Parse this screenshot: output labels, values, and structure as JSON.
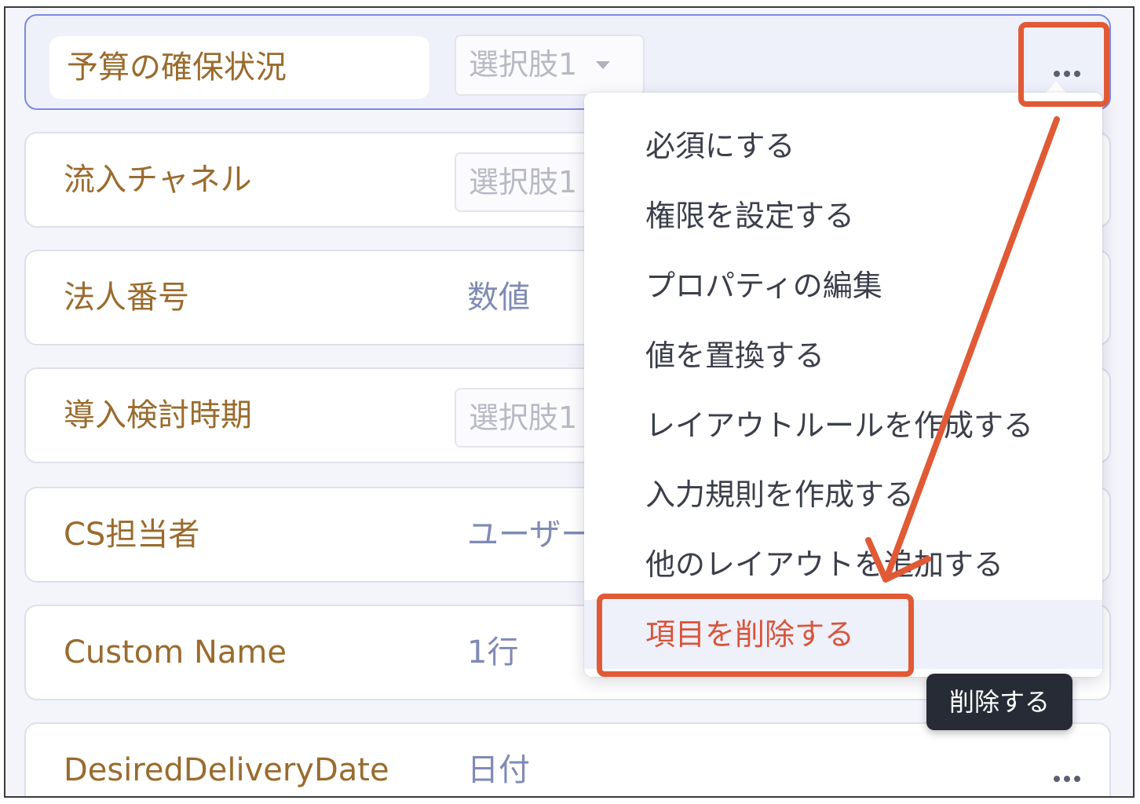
{
  "fields": [
    {
      "label": "予算の確保状況",
      "type": "選択肢1",
      "type_style": "select"
    },
    {
      "label": "流入チャネル",
      "type": "選択肢1",
      "type_style": "select"
    },
    {
      "label": "法人番号",
      "type": "数値",
      "type_style": "plain"
    },
    {
      "label": "導入検討時期",
      "type": "選択肢1",
      "type_style": "select"
    },
    {
      "label": "CS担当者",
      "type": "ユーザー",
      "type_style": "plain"
    },
    {
      "label": "Custom Name",
      "type": "1行",
      "type_style": "plain"
    },
    {
      "label": "DesiredDeliveryDate",
      "type": "日付",
      "type_style": "plain"
    }
  ],
  "menu": {
    "items": [
      {
        "label": "必須にする"
      },
      {
        "label": "権限を設定する"
      },
      {
        "label": "プロパティの編集"
      },
      {
        "label": "値を置換する"
      },
      {
        "label": "レイアウトルールを作成する"
      },
      {
        "label": "入力規則を作成する"
      },
      {
        "label": "他のレイアウトを追加する"
      },
      {
        "label": "項目を削除する"
      }
    ]
  },
  "tooltip": {
    "text": "削除する"
  },
  "icons": {
    "more": "more-horizontal-icon",
    "caret": "caret-down-icon"
  },
  "colors": {
    "accent": "#e05a36",
    "label": "#9a6b2d",
    "danger": "#d8553a"
  }
}
